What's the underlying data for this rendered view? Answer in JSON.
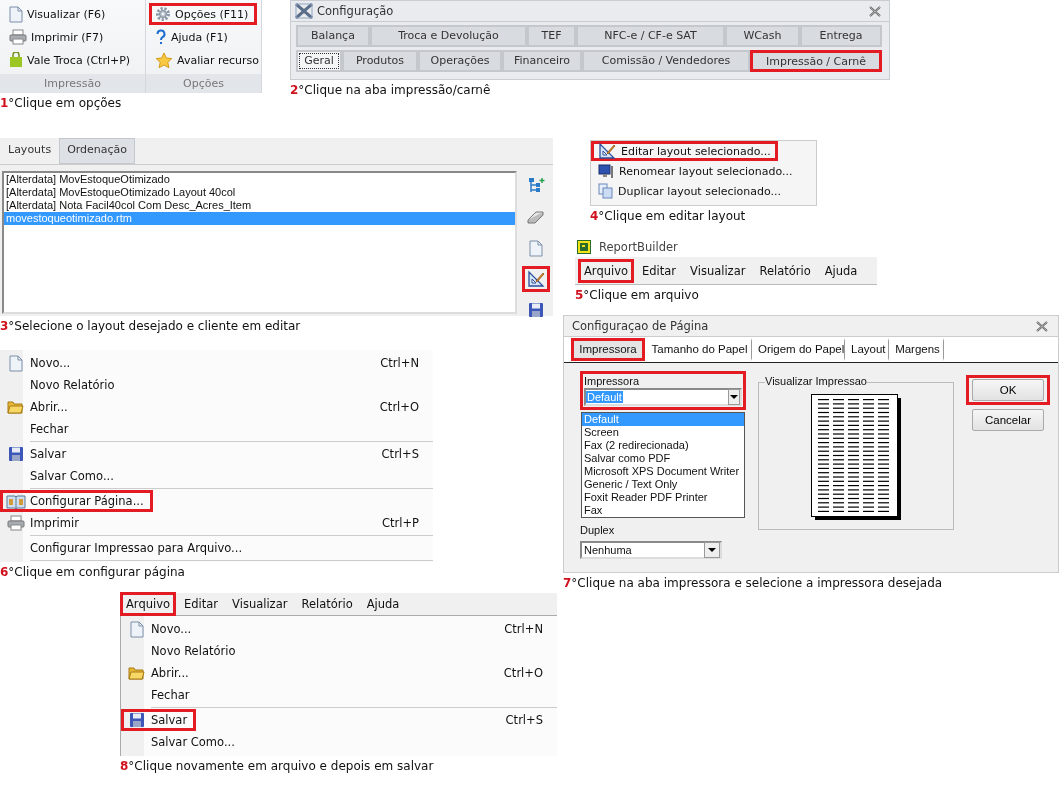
{
  "ribbon": {
    "groups": [
      {
        "label": "Impressão",
        "items": [
          {
            "label": "Visualizar (F6)",
            "highlighted": false
          },
          {
            "label": "Imprimir (F7)",
            "highlighted": false
          },
          {
            "label": "Vale Troca (Ctrl+P)",
            "highlighted": false
          }
        ]
      },
      {
        "label": "Opções",
        "items": [
          {
            "label": "Opções (F11)",
            "highlighted": true
          },
          {
            "label": "Ajuda (F1)",
            "highlighted": false
          },
          {
            "label": "Avaliar recurso",
            "highlighted": false
          }
        ]
      }
    ],
    "caption": {
      "number": "1",
      "text": "°Clique em opções"
    }
  },
  "configuracao_window": {
    "title": "Configuração",
    "tab_rows": [
      [
        {
          "label": "Balança",
          "selected": false,
          "highlighted": false
        },
        {
          "label": "Troca e Devolução",
          "selected": false,
          "highlighted": false
        },
        {
          "label": "TEF",
          "selected": false,
          "highlighted": false
        },
        {
          "label": "NFC-e / CF-e SAT",
          "selected": false,
          "highlighted": false
        },
        {
          "label": "WCash",
          "selected": false,
          "highlighted": false
        },
        {
          "label": "Entrega",
          "selected": false,
          "highlighted": false
        }
      ],
      [
        {
          "label": "Geral",
          "selected": true,
          "highlighted": false
        },
        {
          "label": "Produtos",
          "selected": false,
          "highlighted": false
        },
        {
          "label": "Operações",
          "selected": false,
          "highlighted": false
        },
        {
          "label": "Financeiro",
          "selected": false,
          "highlighted": false
        },
        {
          "label": "Comissão / Vendedores",
          "selected": false,
          "highlighted": false
        },
        {
          "label": "Impressão / Carnê",
          "selected": false,
          "highlighted": true
        }
      ]
    ],
    "caption": {
      "number": "2",
      "text": "°Clique na aba impressão/carnê"
    }
  },
  "layouts_panel": {
    "tabs": [
      {
        "label": "Layouts",
        "selected": true
      },
      {
        "label": "Ordenação",
        "selected": false
      }
    ],
    "items": [
      {
        "label": "[Alterdata] MovEstoqueOtimizado",
        "selected": false
      },
      {
        "label": "[Alterdata] MovEstoqueOtimizado Layout 40col",
        "selected": false
      },
      {
        "label": "[Alterdata] Nota Facil40col Com Desc_Acres_Item",
        "selected": false
      },
      {
        "label": "movestoqueotimizado.rtm",
        "selected": true
      }
    ],
    "tools": [
      {
        "highlighted": false
      },
      {
        "highlighted": false
      },
      {
        "highlighted": false
      },
      {
        "highlighted": true
      },
      {
        "highlighted": false
      }
    ],
    "caption": {
      "number": "3",
      "text": "°Selecione o layout desejado e cliente em editar"
    }
  },
  "context_menu": {
    "items": [
      {
        "label": "Editar layout selecionado...",
        "highlighted": true
      },
      {
        "label": "Renomear layout selecionado...",
        "highlighted": false
      },
      {
        "label": "Duplicar layout selecionado...",
        "highlighted": false
      }
    ],
    "caption": {
      "number": "4",
      "text": "°Clique em editar layout"
    }
  },
  "reportbuilder": {
    "title": "ReportBuilder",
    "menu": [
      {
        "label": "Arquivo",
        "highlighted": true
      },
      {
        "label": "Editar",
        "highlighted": false
      },
      {
        "label": "Visualizar",
        "highlighted": false
      },
      {
        "label": "Relatório",
        "highlighted": false
      },
      {
        "label": "Ajuda",
        "highlighted": false
      }
    ],
    "caption": {
      "number": "5",
      "text": "°Clique em arquivo"
    }
  },
  "file_menu": {
    "groups": [
      [
        {
          "label": "Novo...",
          "shortcut": "Ctrl+N",
          "highlighted": false
        },
        {
          "label": "Novo Relatório",
          "highlighted": false
        },
        {
          "label": "Abrir...",
          "shortcut": "Ctrl+O",
          "highlighted": false
        },
        {
          "label": "Fechar",
          "highlighted": false
        }
      ],
      [
        {
          "label": "Salvar",
          "shortcut": "Ctrl+S",
          "highlighted": false
        },
        {
          "label": "Salvar Como...",
          "highlighted": false
        }
      ],
      [
        {
          "label": "Configurar Página...",
          "highlighted": true
        },
        {
          "label": "Imprimir",
          "shortcut": "Ctrl+P",
          "highlighted": false
        }
      ],
      [
        {
          "label": "Configurar Impressao para Arquivo...",
          "highlighted": false
        }
      ]
    ],
    "caption": {
      "number": "6",
      "text": "°Clique em configurar página"
    }
  },
  "page_setup_dialog": {
    "title": "Configuraçao de Página",
    "tabs": [
      {
        "label": "Impressora",
        "selected": true,
        "highlighted": true
      },
      {
        "label": "Tamanho do Papel",
        "selected": false,
        "highlighted": false
      },
      {
        "label": "Origem do Papel",
        "selected": false,
        "highlighted": false
      },
      {
        "label": "Layout",
        "selected": false,
        "highlighted": false
      },
      {
        "label": "Margens",
        "selected": false,
        "highlighted": false
      }
    ],
    "printer": {
      "label": "Impressora",
      "value": "Default",
      "highlighted": true,
      "options": [
        {
          "label": "Default",
          "selected": true
        },
        {
          "label": "Screen",
          "selected": false
        },
        {
          "label": "Fax (2 redirecionada)",
          "selected": false
        },
        {
          "label": "Salvar como PDF",
          "selected": false
        },
        {
          "label": "Microsoft XPS Document Writer",
          "selected": false
        },
        {
          "label": "Generic / Text Only",
          "selected": false
        },
        {
          "label": "Foxit Reader PDF Printer",
          "selected": false
        },
        {
          "label": "Fax",
          "selected": false
        }
      ]
    },
    "duplex": {
      "label": "Duplex",
      "value": "Nenhuma"
    },
    "preview_label": "Visualizar Impressao",
    "buttons": [
      {
        "label": "OK",
        "highlighted": true
      },
      {
        "label": "Cancelar",
        "highlighted": false
      }
    ],
    "caption": {
      "number": "7",
      "text": "°Clique na aba impressora e selecione a impressora desejada"
    }
  },
  "file_menu_2": {
    "menu": [
      {
        "label": "Arquivo",
        "highlighted": true
      },
      {
        "label": "Editar",
        "highlighted": false
      },
      {
        "label": "Visualizar",
        "highlighted": false
      },
      {
        "label": "Relatório",
        "highlighted": false
      },
      {
        "label": "Ajuda",
        "highlighted": false
      }
    ],
    "groups": [
      [
        {
          "label": "Novo...",
          "shortcut": "Ctrl+N",
          "highlighted": false
        },
        {
          "label": "Novo Relatório",
          "highlighted": false
        },
        {
          "label": "Abrir...",
          "shortcut": "Ctrl+O",
          "highlighted": false
        },
        {
          "label": "Fechar",
          "highlighted": false
        }
      ],
      [
        {
          "label": "Salvar",
          "shortcut": "Ctrl+S",
          "highlighted": true
        },
        {
          "label": "Salvar Como...",
          "highlighted": false
        }
      ]
    ],
    "caption": {
      "number": "8",
      "text": "°Clique novamente em arquivo e depois em salvar"
    }
  }
}
